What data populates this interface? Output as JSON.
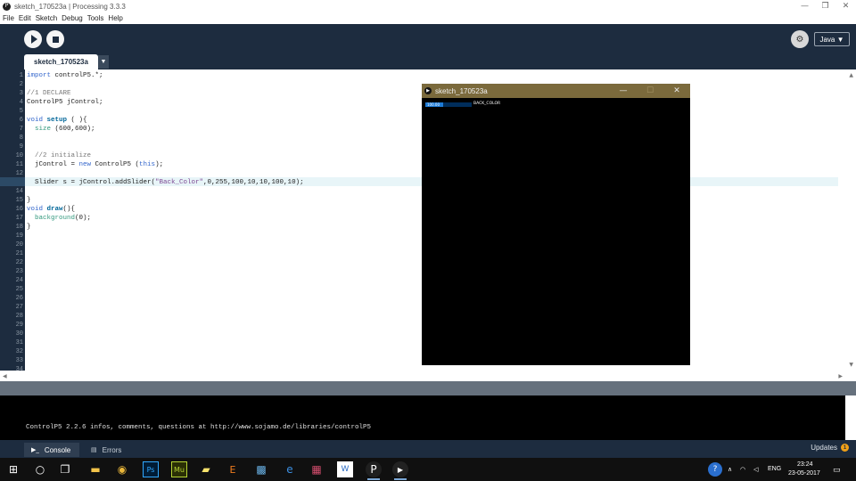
{
  "window": {
    "title": "sketch_170523a | Processing 3.3.3",
    "app_icon_glyph": "P",
    "controls": [
      "—",
      "❐",
      "✕"
    ]
  },
  "menu": [
    "File",
    "Edit",
    "Sketch",
    "Debug",
    "Tools",
    "Help"
  ],
  "toolbar": {
    "run_icon": "play-icon",
    "stop_icon": "stop-icon",
    "debug_glyph": "⚙",
    "mode_label": "Java ▼"
  },
  "tabs": {
    "active_tab": "sketch_170523a",
    "menu_glyph": "▼"
  },
  "editor": {
    "current_line": 13,
    "line_numbers": [
      "1",
      "2",
      "3",
      "4",
      "5",
      "6",
      "7",
      "8",
      "9",
      "10",
      "11",
      "12",
      "13",
      "14",
      "15",
      "16",
      "17",
      "18",
      "19",
      "20",
      "21",
      "22",
      "23",
      "24",
      "25",
      "26",
      "27",
      "28",
      "29",
      "30",
      "31",
      "32",
      "33",
      "34"
    ],
    "lines": [
      [
        {
          "t": "import",
          "c": "kw-blue"
        },
        {
          "t": " controlP5.*;"
        }
      ],
      [],
      [
        {
          "t": "//1 DECLARE",
          "c": "cmt"
        }
      ],
      [
        {
          "t": "ControlP5 jControl;"
        }
      ],
      [],
      [
        {
          "t": "void",
          "c": "kw-blue"
        },
        {
          "t": " "
        },
        {
          "t": "setup",
          "c": "kw-bold"
        },
        {
          "t": " ( ){"
        }
      ],
      [
        {
          "t": "  "
        },
        {
          "t": "size",
          "c": "kw-green"
        },
        {
          "t": " (600,600);"
        }
      ],
      [],
      [],
      [
        {
          "t": "  "
        },
        {
          "t": "//2 initialize",
          "c": "cmt"
        }
      ],
      [
        {
          "t": "  jControl = "
        },
        {
          "t": "new",
          "c": "kw-blue"
        },
        {
          "t": " ControlP5 ("
        },
        {
          "t": "this",
          "c": "kw-blue"
        },
        {
          "t": ");"
        }
      ],
      [],
      [
        {
          "t": "  Slider s = jControl.addSlider("
        },
        {
          "t": "\"Back_Color\"",
          "c": "str"
        },
        {
          "t": ",0,255,100,10,10,100,10);"
        }
      ],
      [],
      [
        {
          "t": "}"
        }
      ],
      [
        {
          "t": "void",
          "c": "kw-blue"
        },
        {
          "t": " "
        },
        {
          "t": "draw",
          "c": "kw-bold"
        },
        {
          "t": "(){"
        }
      ],
      [
        {
          "t": "  "
        },
        {
          "t": "background",
          "c": "kw-green"
        },
        {
          "t": "(0);"
        }
      ],
      [
        {
          "t": "}"
        }
      ]
    ]
  },
  "sketch_window": {
    "title": "sketch_170523a",
    "controls": [
      "—",
      "☐",
      "✕"
    ],
    "slider": {
      "value_label": "100.00",
      "name": "BACK_COLOR",
      "value": 100,
      "min": 0,
      "max": 255
    }
  },
  "console": {
    "text": "ControlP5 2.2.6 infos, comments, questions at http://www.sojamo.de/libraries/controlP5"
  },
  "footer": {
    "console_tab": "Console",
    "errors_tab": "Errors",
    "updates_label": "Updates",
    "updates_count": "1"
  },
  "taskbar": {
    "icons": [
      {
        "name": "windows-start-icon",
        "glyph": "⊞",
        "color": "#ffffff"
      },
      {
        "name": "cortana-search-icon",
        "glyph": "○",
        "color": "#ffffff"
      },
      {
        "name": "task-view-icon",
        "glyph": "❐",
        "color": "#ffffff"
      },
      {
        "name": "file-explorer-icon",
        "glyph": "▬",
        "color": "#f3c34a"
      },
      {
        "name": "chrome-icon",
        "glyph": "◉",
        "color": "#e9b63a"
      },
      {
        "name": "photoshop-icon",
        "glyph": "Ps",
        "color": "#31a8ff"
      },
      {
        "name": "muse-icon",
        "glyph": "Mu",
        "color": "#b5d334"
      },
      {
        "name": "sticky-notes-icon",
        "glyph": "▰",
        "color": "#f8e36c"
      },
      {
        "name": "app-e-icon",
        "glyph": "E",
        "color": "#f07d1e"
      },
      {
        "name": "photos-icon",
        "glyph": "▩",
        "color": "#6ab3e8"
      },
      {
        "name": "edge-icon",
        "glyph": "e",
        "color": "#3c8fe2"
      },
      {
        "name": "store-icon",
        "glyph": "▦",
        "color": "#d24d6d"
      },
      {
        "name": "word-icon",
        "glyph": "W",
        "color": "#2b6cc4"
      },
      {
        "name": "processing-icon",
        "glyph": "P",
        "color": "#ffffff"
      },
      {
        "name": "sketch-running-icon",
        "glyph": "▶",
        "color": "#ffffff"
      }
    ],
    "tray": {
      "help_glyph": "?",
      "chevron_glyph": "∧",
      "network_glyph": "◠",
      "volume_glyph": "◁",
      "language": "ENG",
      "time": "23:24",
      "date": "23-05-2017",
      "notification_glyph": "▭"
    }
  }
}
